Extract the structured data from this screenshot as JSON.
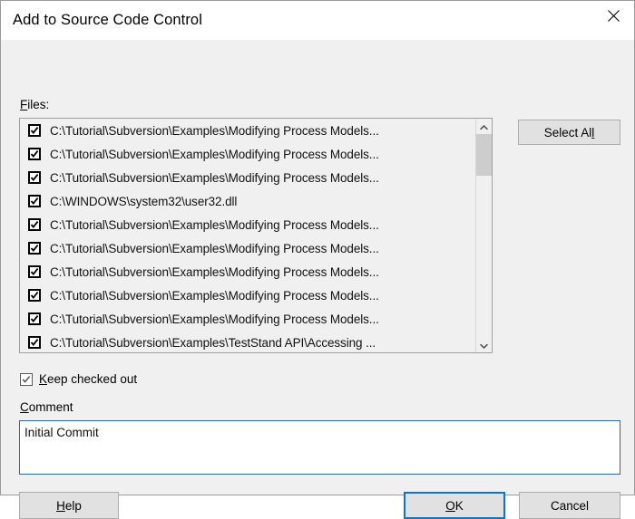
{
  "window": {
    "title": "Add to Source Code Control",
    "close_icon": "close-icon"
  },
  "files_section": {
    "label": "Files:",
    "label_accel": "F",
    "label_rest": "iles:",
    "select_all_button": {
      "text_before": "Select Al",
      "accel": "l",
      "text_after": "",
      "full_label": "Select All"
    },
    "scrollbar": {
      "up_arrow_icon": "chevron-up-icon",
      "down_arrow_icon": "chevron-down-icon"
    },
    "rows": [
      {
        "checked": true,
        "path": "C:\\Tutorial\\Subversion\\Examples\\Modifying Process Models..."
      },
      {
        "checked": true,
        "path": "C:\\Tutorial\\Subversion\\Examples\\Modifying Process Models..."
      },
      {
        "checked": true,
        "path": "C:\\Tutorial\\Subversion\\Examples\\Modifying Process Models..."
      },
      {
        "checked": true,
        "path": "C:\\WINDOWS\\system32\\user32.dll"
      },
      {
        "checked": true,
        "path": "C:\\Tutorial\\Subversion\\Examples\\Modifying Process Models..."
      },
      {
        "checked": true,
        "path": "C:\\Tutorial\\Subversion\\Examples\\Modifying Process Models..."
      },
      {
        "checked": true,
        "path": "C:\\Tutorial\\Subversion\\Examples\\Modifying Process Models..."
      },
      {
        "checked": true,
        "path": "C:\\Tutorial\\Subversion\\Examples\\Modifying Process Models..."
      },
      {
        "checked": true,
        "path": "C:\\Tutorial\\Subversion\\Examples\\Modifying Process Models..."
      },
      {
        "checked": true,
        "path": "C:\\Tutorial\\Subversion\\Examples\\TestStand API\\Accessing ..."
      }
    ]
  },
  "keep_checked_out": {
    "checked": true,
    "accel": "K",
    "label_rest": "eep checked out",
    "full_label": "Keep checked out"
  },
  "comment": {
    "label_accel": "C",
    "label_rest": "omment",
    "full_label": "Comment",
    "value": "Initial Commit",
    "placeholder": ""
  },
  "buttons": {
    "help": {
      "accel": "H",
      "rest": "elp",
      "full_label": "Help"
    },
    "ok": {
      "accel": "O",
      "rest": "K",
      "full_label": "OK"
    },
    "cancel": {
      "full_label": "Cancel"
    }
  },
  "colors": {
    "accent": "#0078d7",
    "button_face": "#e1e1e1",
    "dialog_bg": "#f0f0f0",
    "list_bg": "#f0f0f0"
  }
}
